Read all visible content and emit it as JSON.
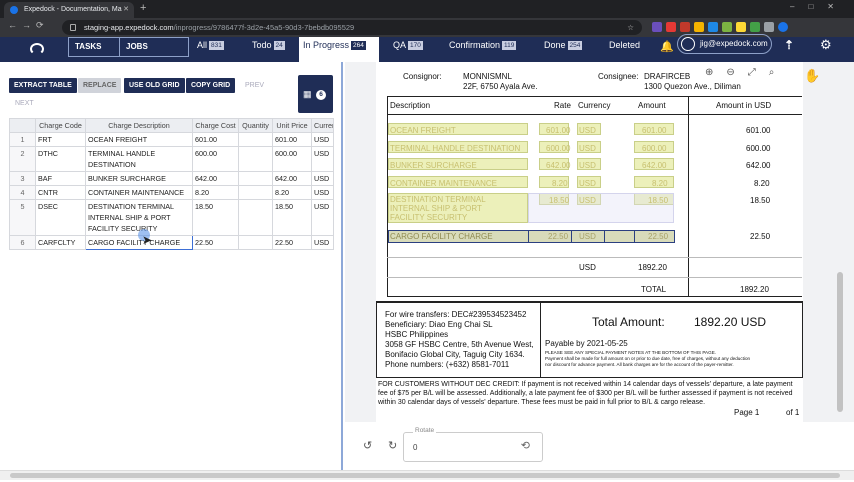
{
  "browser": {
    "tab_title": "Expedock - Documentation, Ma",
    "url_host": "staging-app.expedock.com",
    "url_path": "/inprogress/9786477f-3d2e-45a5-90d3-7bebdb095529"
  },
  "appbar": {
    "tasks": "TASKS",
    "jobs": "JOBS",
    "stats": [
      {
        "label": "All",
        "count": "831"
      },
      {
        "label": "Todo",
        "count": "24"
      },
      {
        "label": "In Progress",
        "count": "264"
      },
      {
        "label": "QA",
        "count": "170"
      },
      {
        "label": "Confirmation",
        "count": "119"
      },
      {
        "label": "Done",
        "count": "254"
      },
      {
        "label": "Deleted",
        "count": ""
      }
    ],
    "user": "jig@expedock.com"
  },
  "toolbar": {
    "extract": "EXTRACT TABLE",
    "replace": "REPLACE",
    "old_grid": "USE OLD GRID",
    "copy_grid": "COPY GRID",
    "prev": "PREV",
    "next": "NEXT",
    "grid_count": "6"
  },
  "grid": {
    "headers": [
      "",
      "Charge Code",
      "Charge Description",
      "Charge Cost",
      "Quantity",
      "Unit Price",
      "Curren"
    ],
    "rows": [
      {
        "n": "1",
        "code": "FRT",
        "desc": "OCEAN FREIGHT",
        "cost": "601.00",
        "qty": "",
        "unit": "601.00",
        "cur": "USD"
      },
      {
        "n": "2",
        "code": "DTHC",
        "desc": "TERMINAL HANDLE DESTINATION",
        "cost": "600.00",
        "qty": "",
        "unit": "600.00",
        "cur": "USD"
      },
      {
        "n": "3",
        "code": "BAF",
        "desc": "BUNKER SURCHARGE",
        "cost": "642.00",
        "qty": "",
        "unit": "642.00",
        "cur": "USD"
      },
      {
        "n": "4",
        "code": "CNTR",
        "desc": "CONTAINER MAINTENANCE",
        "cost": "8.20",
        "qty": "",
        "unit": "8.20",
        "cur": "USD"
      },
      {
        "n": "5",
        "code": "DSEC",
        "desc": "DESTINATION TERMINAL INTERNAL SHIP & PORT FACILITY SECURITY",
        "cost": "18.50",
        "qty": "",
        "unit": "18.50",
        "cur": "USD"
      },
      {
        "n": "6",
        "code": "CARFCLTY",
        "desc": "CARGO FACILITY CHARGE",
        "cost": "22.50",
        "qty": "",
        "unit": "22.50",
        "cur": "USD"
      }
    ]
  },
  "doc": {
    "consignor_label": "Consignor:",
    "consignor_name": "MONNISMNL",
    "consignor_addr": "22F, 6750 Ayala Ave.",
    "consignee_label": "Consignee:",
    "consignee_name": "DRAFIRCEB",
    "consignee_addr": "1300 Quezon Ave., Diliman",
    "col_desc": "Description",
    "col_rate": "Rate",
    "col_currency": "Currency",
    "col_amount": "Amount",
    "col_amount_usd": "Amount in USD",
    "lines": [
      {
        "desc": "OCEAN FREIGHT",
        "rate": "601.00",
        "cur": "USD",
        "amt": "601.00",
        "usd": "601.00"
      },
      {
        "desc": "TERMINAL HANDLE DESTINATION",
        "rate": "600.00",
        "cur": "USD",
        "amt": "600.00",
        "usd": "600.00"
      },
      {
        "desc": "BUNKER SURCHARGE",
        "rate": "642.00",
        "cur": "USD",
        "amt": "642.00",
        "usd": "642.00"
      },
      {
        "desc": "CONTAINER MAINTENANCE",
        "rate": "8.20",
        "cur": "USD",
        "amt": "8.20",
        "usd": "8.20"
      },
      {
        "desc": "DESTINATION TERMINAL",
        "desc2": "INTERNAL SHIP & PORT",
        "desc3": "FACILITY SECURITY",
        "rate": "18.50",
        "cur": "USD",
        "amt": "18.50",
        "usd": "18.50"
      },
      {
        "desc": "CARGO FACILITY CHARGE",
        "rate": "22.50",
        "cur": "USD",
        "amt": "22.50",
        "usd": "22.50"
      }
    ],
    "subtotal_cur": "USD",
    "subtotal": "1892.20",
    "total_label": "TOTAL",
    "total": "1892.20",
    "wire": [
      "For wire transfers: DEC#239534523452",
      "Beneficiary: Diao Eng Chai SL",
      "HSBC Philippines",
      "3058 GF HSBC Centre, 5th Avenue West,",
      "Bonifacio Global City, Taguig City 1634.",
      "Phone numbers: (+632) 8581-7011"
    ],
    "total_amount_label": "Total Amount:",
    "total_amount": "1892.20 USD",
    "payable": "Payable by 2021-05-25",
    "notes": [
      "PLEASE SEE ANY SPECIAL PAYMENT NOTES AT THE BOTTOM OF THIS PAGE.",
      "Payment shall be made for full amount on or prior to due date, free of charges, without any deduction",
      "nor discount for advance payment. All bank charges are for the account of the payer-remitter."
    ],
    "credit": [
      "FOR CUSTOMERS WITHOUT DEC CREDIT: If payment is not received within 14 calendar days of vessels' departure, a late payment",
      "fee of $75 per B/L will be assessed. Additionally, a late payment fee of $300 per B/L will be further assessed if payment is not received",
      "within 30 calendar days of vessels' departure. These fees must be paid in full prior to B/L & cargo release."
    ],
    "page": "Page 1",
    "of": "of 1"
  },
  "rotate": {
    "label": "Rotate",
    "value": "0"
  }
}
